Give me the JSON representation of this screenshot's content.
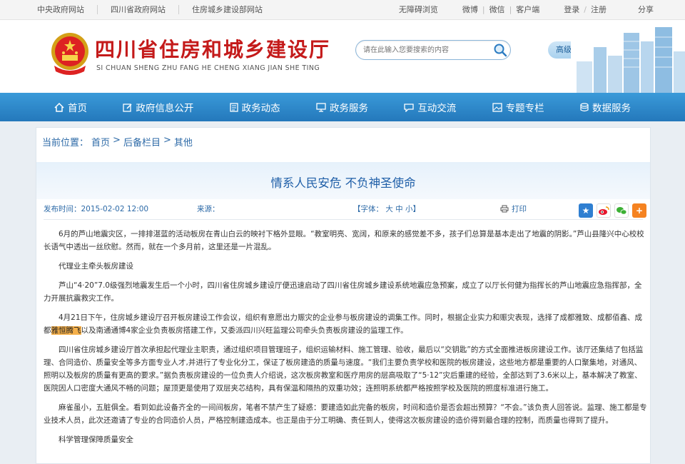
{
  "topbar": {
    "links": [
      "中央政府网站",
      "四川省政府网站",
      "住房城乡建设部网站"
    ],
    "accessible": "无障碍浏览",
    "weibo": "微博",
    "weixin": "微信",
    "client": "客户端",
    "login": "登录",
    "register": "注册",
    "share": "分享"
  },
  "header": {
    "title": "四川省住房和城乡建设厅",
    "pinyin": "SI CHUAN SHENG ZHU FANG HE CHENG XIANG JIAN SHE TING",
    "search_placeholder": "请在此输入您要搜索的内容",
    "adv_search": "高级搜索"
  },
  "nav": {
    "items": [
      {
        "label": "首页",
        "icon": "home-icon"
      },
      {
        "label": "政府信息公开",
        "icon": "edit-icon"
      },
      {
        "label": "政务动态",
        "icon": "document-icon"
      },
      {
        "label": "政务服务",
        "icon": "monitor-icon"
      },
      {
        "label": "互动交流",
        "icon": "chat-icon"
      },
      {
        "label": "专题专栏",
        "icon": "image-icon"
      },
      {
        "label": "数据服务",
        "icon": "database-icon"
      }
    ]
  },
  "breadcrumb": {
    "label": "当前位置：",
    "items": [
      "首页",
      ">",
      "后备栏目",
      ">",
      "其他"
    ]
  },
  "article": {
    "title": "情系人民安危 不负神圣使命",
    "date": "发布时间：2015-02-02 12:00",
    "source": "来源：",
    "fontsize": "【字体： 大 中 小】",
    "print": "打印",
    "p1": "6月的芦山地震灾区，一排排湛蓝的活动板房在青山白云的映衬下格外显眼。“教室明亮、宽阔，和原来的感觉差不多，孩子们总算是基本走出了地震的阴影。”芦山县隆兴中心校校长语气中透出一丝欣慰。然而，就在一个多月前，这里还是一片混乱。",
    "h1": "代理业主牵头板房建设",
    "p2": "芦山“4·20”7.0级强烈地震发生后一个小时，四川省住房城乡建设厅便迅速启动了四川省住房城乡建设系统地震应急预案，成立了以厅长何健为指挥长的芦山地震应急指挥部，全力开展抗震救灾工作。",
    "p3a": "4月21日下午，住房城乡建设厅召开板房建设工作会议，组织有意愿出力赈灾的企业参与板房建设的调集工作。同时，根据企业实力和赈灾表现，选择了成都雅致、成都佰鑫、成都",
    "p3hl": "雅恒腾飞",
    "p3b": "以及南通通博4家企业负责板房搭建工作，又委派四川兴旺监理公司牵头负责板房建设的监理工作。",
    "p4": "四川省住房城乡建设厅首次承担起代理业主职责，通过组织项目管理班子，组织运输材料、施工管理、验收，最后以“交钥匙”的方式全面推进板房建设工作。该厅还集结了包括监理、合同造价、质量安全等多方面专业人才,并进行了专业化分工，保证了板房建造的质量与速度。“我们主要负责学校和医院的板房建设，这些地方都是重要的人口聚集地，对通风、照明以及板房的质量有更高的要求。”据负责板房建设的一位负责人介绍说，这次板房教室和医疗用房的层高吸取了“5·12”灾后重建的经验，全部达到了3.6米以上，基本解决了教室、医院因人口密度大通风不畅的问题；屋顶更是使用了双层夹芯结构，具有保温和隔热的双重功效；连照明系统都严格按照学校及医院的照度标准进行施工。",
    "p5": "麻雀虽小，五脏俱全。看到如此设备齐全的一间间板房，笔者不禁产生了疑惑：要建造如此完备的板房，时间和造价是否会超出预算？“不会。”该负责人回答说。监理、施工都是专业技术人员，此次还邀请了专业的合同造价人员，严格控制建造成本。也正是由于分工明确、责任到人，使得这次板房建设的造价得到最合理的控制，而质量也得到了提升。",
    "h2": "科学管理保障质量安全"
  }
}
